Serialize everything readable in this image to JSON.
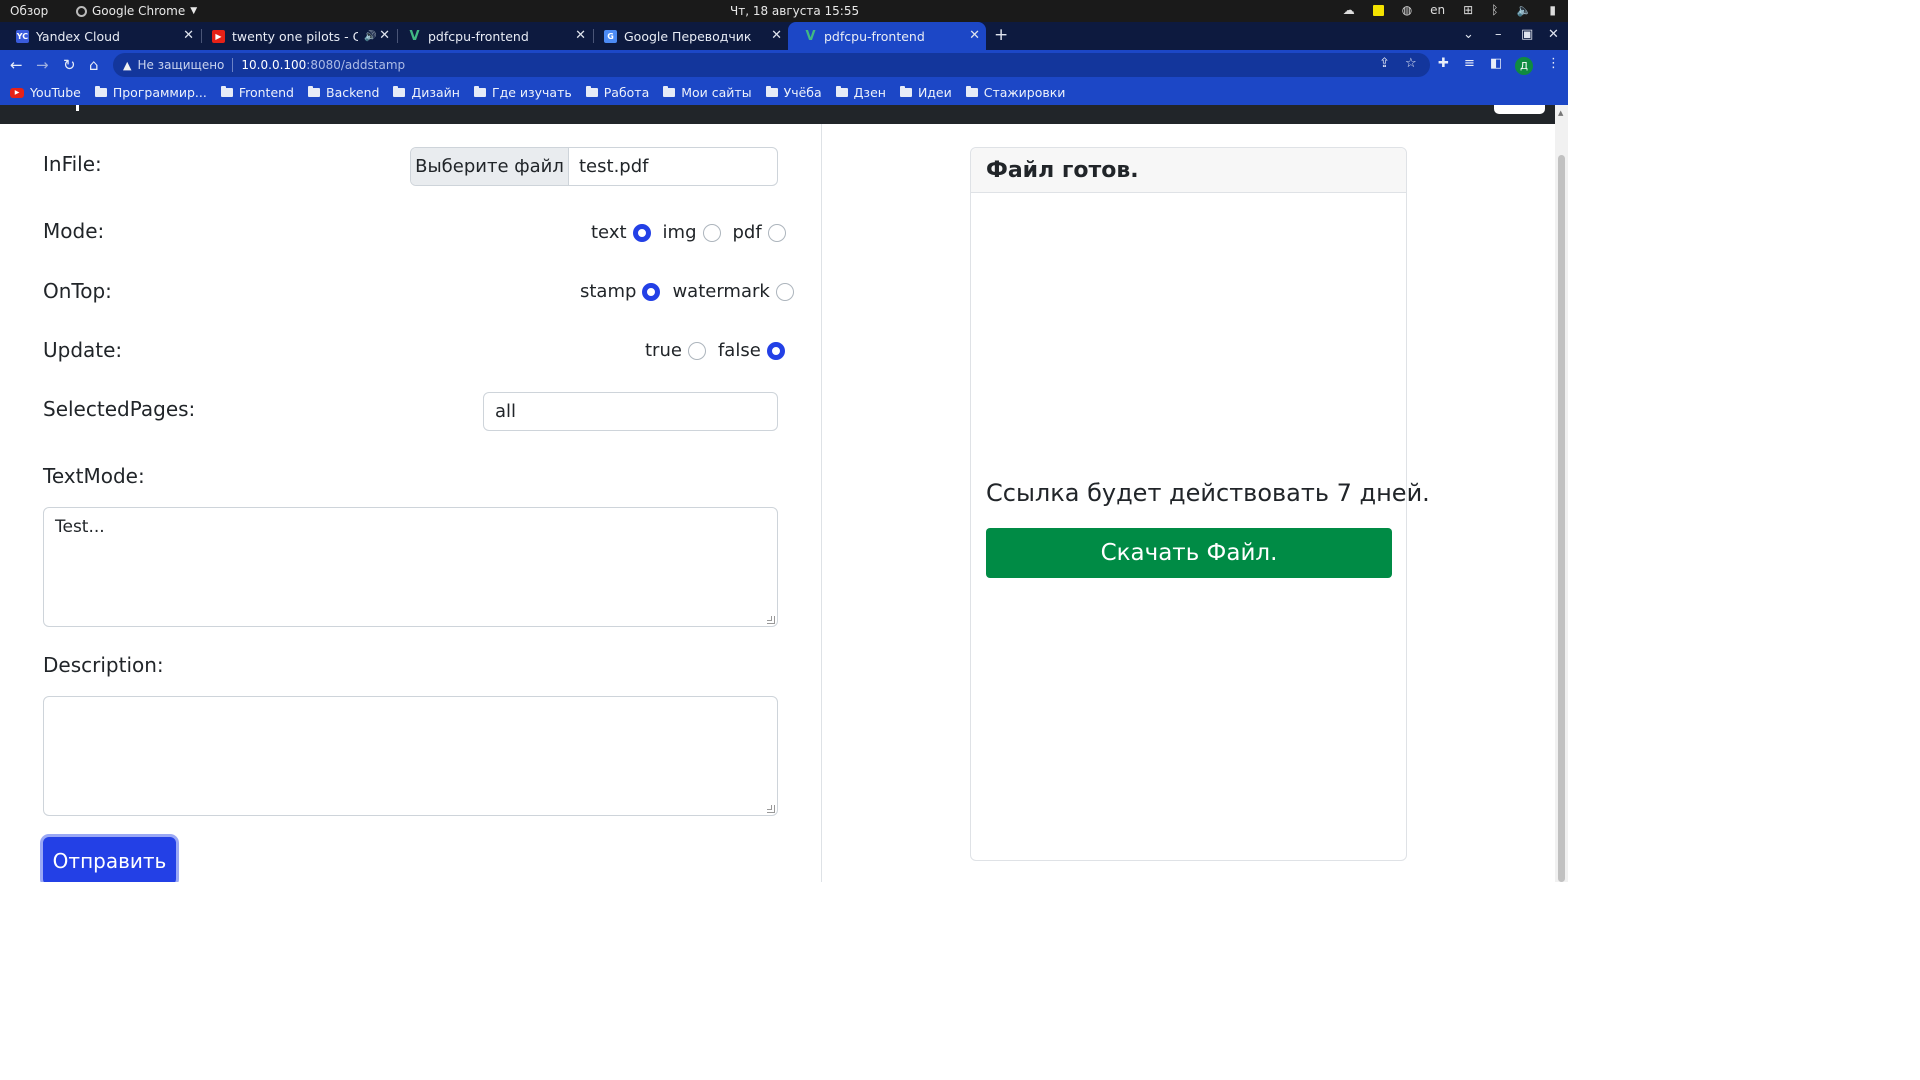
{
  "system": {
    "overview": "Обзор",
    "app_name": "Google Chrome",
    "clock": "Чт, 18 августа  15:55",
    "lang": "en"
  },
  "tabs": [
    {
      "title": "Yandex Cloud",
      "favicon": "yandex-cloud-icon",
      "color": "#3a5bdb"
    },
    {
      "title": "twenty one pilots - Chl",
      "favicon": "youtube-icon",
      "color": "#e62117"
    },
    {
      "title": "pdfcpu-frontend",
      "favicon": "vue-icon",
      "color": "#41b883"
    },
    {
      "title": "Google Переводчик",
      "favicon": "google-translate-icon",
      "color": "#4c8bf5"
    },
    {
      "title": "pdfcpu-frontend",
      "favicon": "vue-icon",
      "color": "#41b883"
    }
  ],
  "address": {
    "security": "Не защищено",
    "host": "10.0.0.100",
    "path": ":8080/addstamp"
  },
  "profile_initial": "Д",
  "bookmarks": [
    "YouTube",
    "Программир...",
    "Frontend",
    "Backend",
    "Дизайн",
    "Где изучать",
    "Работа",
    "Мои сайты",
    "Учёба",
    "Дзен",
    "Идеи",
    "Стажировки"
  ],
  "form": {
    "infile_label": "InFile:",
    "file_button": "Выберите файл",
    "file_name": "test.pdf",
    "mode_label": "Mode:",
    "mode_options": [
      "text",
      "img",
      "pdf"
    ],
    "mode_selected": "text",
    "ontop_label": "OnTop:",
    "ontop_options": [
      "stamp",
      "watermark"
    ],
    "ontop_selected": "stamp",
    "update_label": "Update:",
    "update_options": [
      "true",
      "false"
    ],
    "update_selected": "false",
    "pages_label": "SelectedPages:",
    "pages_value": "all",
    "textmode_label": "TextMode:",
    "textmode_value": "Test...",
    "description_label": "Description:",
    "description_value": "",
    "submit_label": "Отправить"
  },
  "result": {
    "header": "Файл готов.",
    "message": "Ссылка будет действовать 7 дней.",
    "download_label": "Скачать Файл."
  },
  "colors": {
    "chrome_accent": "#1c47c6",
    "primary": "#2340e6",
    "success": "#008b45"
  }
}
